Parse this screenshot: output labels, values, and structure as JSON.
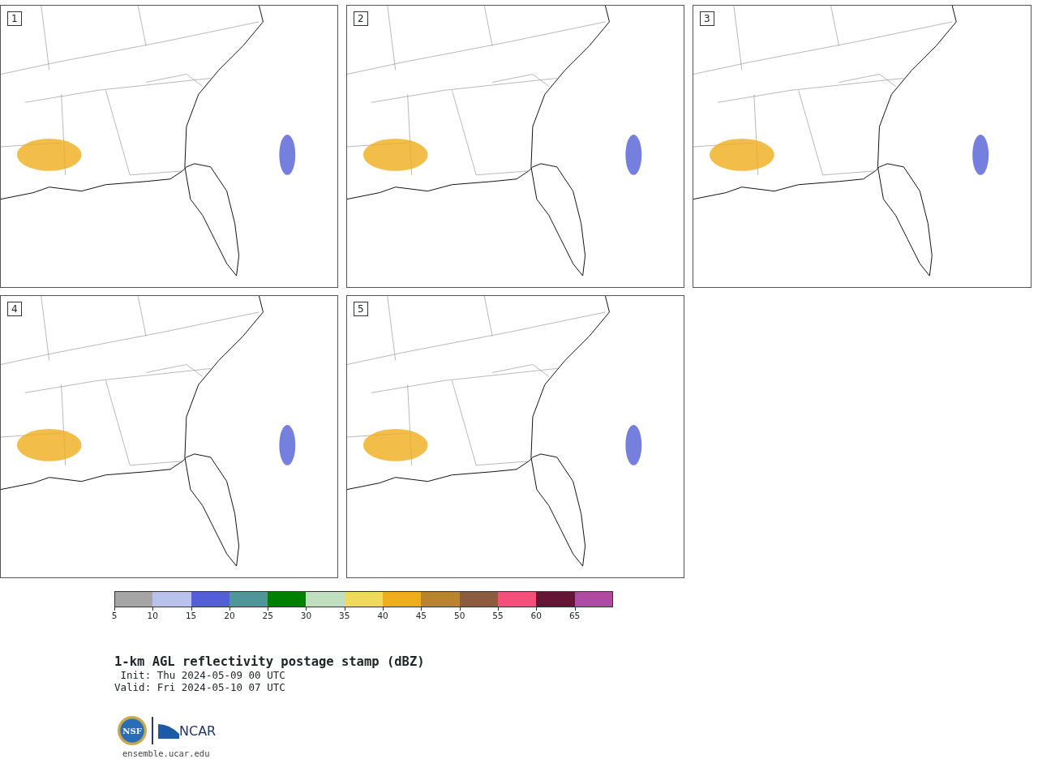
{
  "panels": [
    {
      "label": "1"
    },
    {
      "label": "2"
    },
    {
      "label": "3"
    },
    {
      "label": "4"
    },
    {
      "label": "5"
    }
  ],
  "colorbar": {
    "segments": [
      {
        "color": "#a5a5a5",
        "tick": "5"
      },
      {
        "color": "#b8c2ed",
        "tick": "10"
      },
      {
        "color": "#525fd6",
        "tick": "15"
      },
      {
        "color": "#4f969b",
        "tick": "20"
      },
      {
        "color": "#008000",
        "tick": "25"
      },
      {
        "color": "#c0dfbf",
        "tick": "30"
      },
      {
        "color": "#efda5e",
        "tick": "35"
      },
      {
        "color": "#efae1c",
        "tick": "40"
      },
      {
        "color": "#ba832f",
        "tick": "45"
      },
      {
        "color": "#8b5c3e",
        "tick": "50"
      },
      {
        "color": "#f4507c",
        "tick": "55"
      },
      {
        "color": "#641634",
        "tick": "60"
      },
      {
        "color": "#ae4ca5",
        "tick": "65"
      }
    ]
  },
  "title": "1-km AGL reflectivity postage stamp (dBZ)",
  "init": " Init: Thu 2024-05-09 00 UTC",
  "valid": "Valid: Fri 2024-05-10 07 UTC",
  "logo": {
    "seal": "NSF",
    "name": "NCAR"
  },
  "url": "ensemble.ucar.edu"
}
